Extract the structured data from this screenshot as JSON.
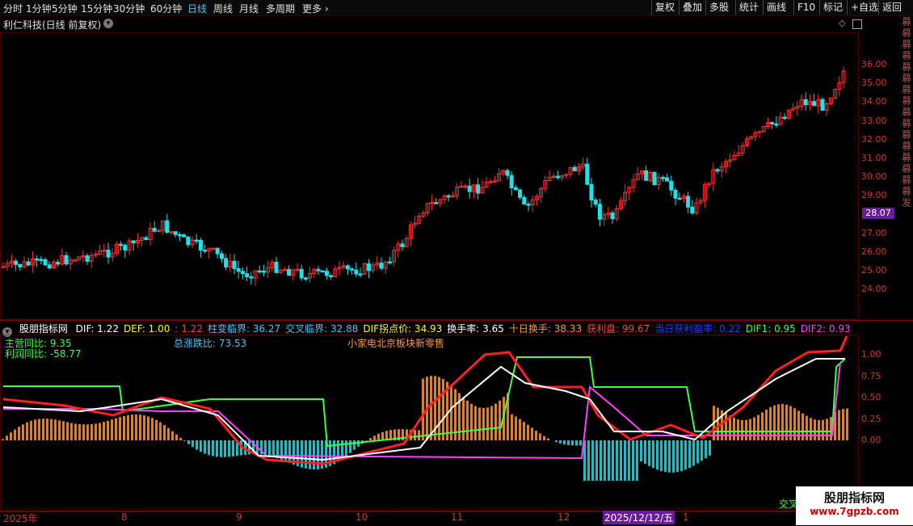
{
  "toolbar": {
    "periods": [
      "分时",
      "1分钟",
      "5分钟",
      "15分钟",
      "30分钟",
      "60分钟",
      "日线",
      "周线",
      "月线",
      "多周期",
      "更多"
    ],
    "active_period": "日线",
    "tools": [
      "复权",
      "叠加",
      "多股",
      "统计",
      "画线",
      "F10",
      "标记",
      "+自选",
      "返回"
    ]
  },
  "stock": {
    "title": "利仁科技(日线 前复权)"
  },
  "price_axis": {
    "ticks": [
      "36.00",
      "35.00",
      "34.00",
      "33.00",
      "32.00",
      "31.00",
      "30.00",
      "29.00",
      "28.00",
      "27.00",
      "26.00",
      "25.00",
      "24.00"
    ],
    "current": "28.07"
  },
  "indicator": {
    "name": "股朋指标网",
    "items": [
      {
        "text": "DIF: 1.22",
        "color": "#ffffff"
      },
      {
        "text": "DEF: 1.00",
        "color": "#ffff00"
      },
      {
        "text": ": 1.22",
        "color": "#ff4040"
      },
      {
        "text": "柱变临界: 36.27",
        "color": "#4fc3f7"
      },
      {
        "text": "交叉临界: 32.88",
        "color": "#4fc3f7"
      },
      {
        "text": "DIF拐点价: 34.93",
        "color": "#ffff00"
      },
      {
        "text": "换手率: 3.65",
        "color": "#ffffff"
      },
      {
        "text": "十日换手: 38.33",
        "color": "#ff9933"
      },
      {
        "text": "获利盘: 99.67",
        "color": "#ff4040"
      },
      {
        "text": "当日获利盈率: 0.22",
        "color": "#2040ff"
      },
      {
        "text": "DIF1: 0.95",
        "color": "#40ff40"
      },
      {
        "text": "DIF2: 0.93",
        "color": "#ff40ff"
      }
    ],
    "revenue_yoy": "主营同比: 9.35",
    "profit_yoy": "利润同比: -58.77",
    "total_change": "总涨跌比: 73.53",
    "sector": "小家电北京板块新零售",
    "axis": [
      "1.00",
      "0.75",
      "0.50",
      "0.25",
      "0.00"
    ]
  },
  "dates": {
    "labels": [
      "2025年",
      "8",
      "9",
      "10",
      "11",
      "12",
      "1"
    ],
    "selected": "2025/12/12/五"
  },
  "right_strip": "募募募募募募募募募募募募募募募募发",
  "watermark": {
    "name": "股朋指标网",
    "url": "www.7gpzb.com"
  },
  "bottom_hint": "交叉",
  "colors": {
    "up": "#ff3030",
    "down": "#20e0e8",
    "frame": "#8b0000"
  }
}
